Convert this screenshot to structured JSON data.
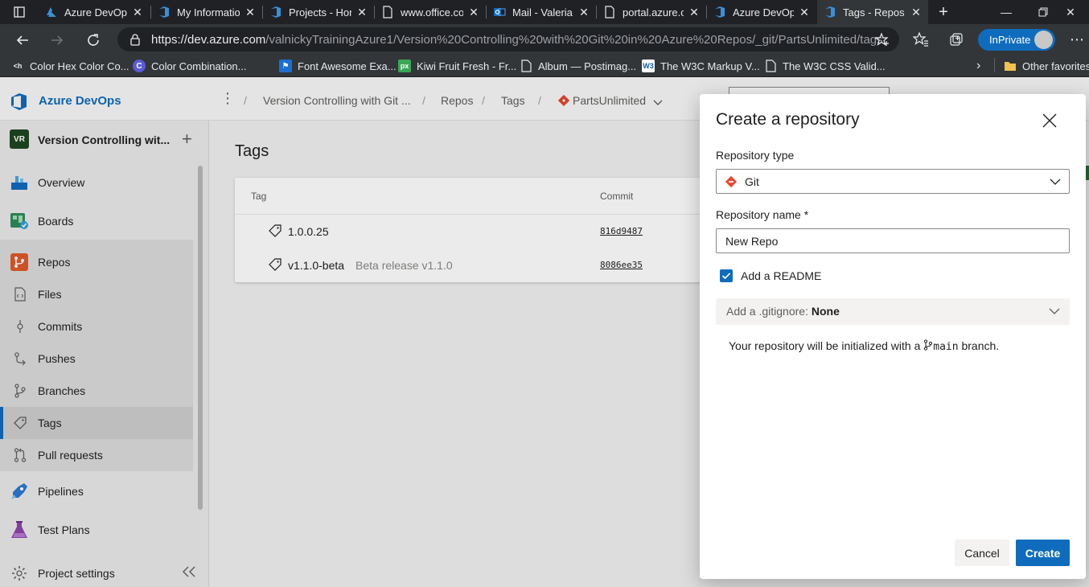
{
  "browser": {
    "tabs": [
      {
        "title": "Azure DevOps",
        "icon": "azure-devops-icon",
        "active": false
      },
      {
        "title": "My Informatio",
        "icon": "azure-devops-icon",
        "active": false
      },
      {
        "title": "Projects - Hom",
        "icon": "azure-devops-icon",
        "active": false
      },
      {
        "title": "www.office.co",
        "icon": "page-icon",
        "active": false
      },
      {
        "title": "Mail - Valeria",
        "icon": "outlook-icon",
        "active": false
      },
      {
        "title": "portal.azure.c",
        "icon": "page-icon",
        "active": false
      },
      {
        "title": "Azure DevOps",
        "icon": "azure-devops-icon",
        "active": false
      },
      {
        "title": "Tags - Repos",
        "icon": "azure-devops-icon",
        "active": true
      }
    ],
    "url_host": "https://dev.azure.com",
    "url_path": "/valnickyTrainingAzure1/Version%20Controlling%20with%20Git%20in%20Azure%20Repos/_git/PartsUnlimited/tags",
    "inprivate_label": "InPrivate",
    "favorites": [
      {
        "label": "Color Hex Color Co...",
        "icon": "hex-icon"
      },
      {
        "label": "Color Combination...",
        "icon": "c-icon"
      },
      {
        "label": "Font Awesome Exa...",
        "icon": "flag-icon"
      },
      {
        "label": "Kiwi Fruit Fresh - Fr...",
        "icon": "px-icon"
      },
      {
        "label": "Album — Postimag...",
        "icon": "page-icon"
      },
      {
        "label": "The W3C Markup V...",
        "icon": "w3c-icon"
      },
      {
        "label": "The W3C CSS Valid...",
        "icon": "page-icon"
      }
    ],
    "other_favorites": "Other favorites"
  },
  "app": {
    "brand": "Azure DevOps",
    "breadcrumb": [
      "Version Controlling with Git ...",
      "Repos",
      "Tags",
      "PartsUnlimited"
    ],
    "project": {
      "badge": "VR",
      "name": "Version Controlling wit..."
    },
    "nav": [
      {
        "label": "Overview",
        "icon": "overview-icon"
      },
      {
        "label": "Boards",
        "icon": "boards-icon"
      },
      {
        "label": "Repos",
        "icon": "repos-icon"
      },
      {
        "label": "Files",
        "icon": "files-icon"
      },
      {
        "label": "Commits",
        "icon": "commits-icon"
      },
      {
        "label": "Pushes",
        "icon": "pushes-icon"
      },
      {
        "label": "Branches",
        "icon": "branches-icon"
      },
      {
        "label": "Tags",
        "icon": "tag-icon"
      },
      {
        "label": "Pull requests",
        "icon": "pull-request-icon"
      },
      {
        "label": "Pipelines",
        "icon": "pipelines-icon"
      },
      {
        "label": "Test Plans",
        "icon": "test-plans-icon"
      }
    ],
    "project_settings": "Project settings",
    "page_title": "Tags",
    "table": {
      "columns": [
        "Tag",
        "Commit"
      ],
      "rows": [
        {
          "tag": "1.0.0.25",
          "message": "",
          "commit": "816d9487"
        },
        {
          "tag": "v1.1.0-beta",
          "message": "Beta release v1.1.0",
          "commit": "8086ee35"
        }
      ]
    }
  },
  "dialog": {
    "title": "Create a repository",
    "repo_type_label": "Repository type",
    "repo_type_value": "Git",
    "repo_name_label": "Repository name *",
    "repo_name_value": "New Repo",
    "readme_label": "Add a README",
    "readme_checked": true,
    "gitignore_prefix": "Add a .gitignore:",
    "gitignore_value": "None",
    "init_msg_before": "Your repository will be initialized with a",
    "init_branch": "main",
    "init_msg_after": "branch.",
    "cancel_label": "Cancel",
    "create_label": "Create"
  },
  "colors": {
    "accent": "#0f6cbd",
    "git": "#e8442c"
  }
}
